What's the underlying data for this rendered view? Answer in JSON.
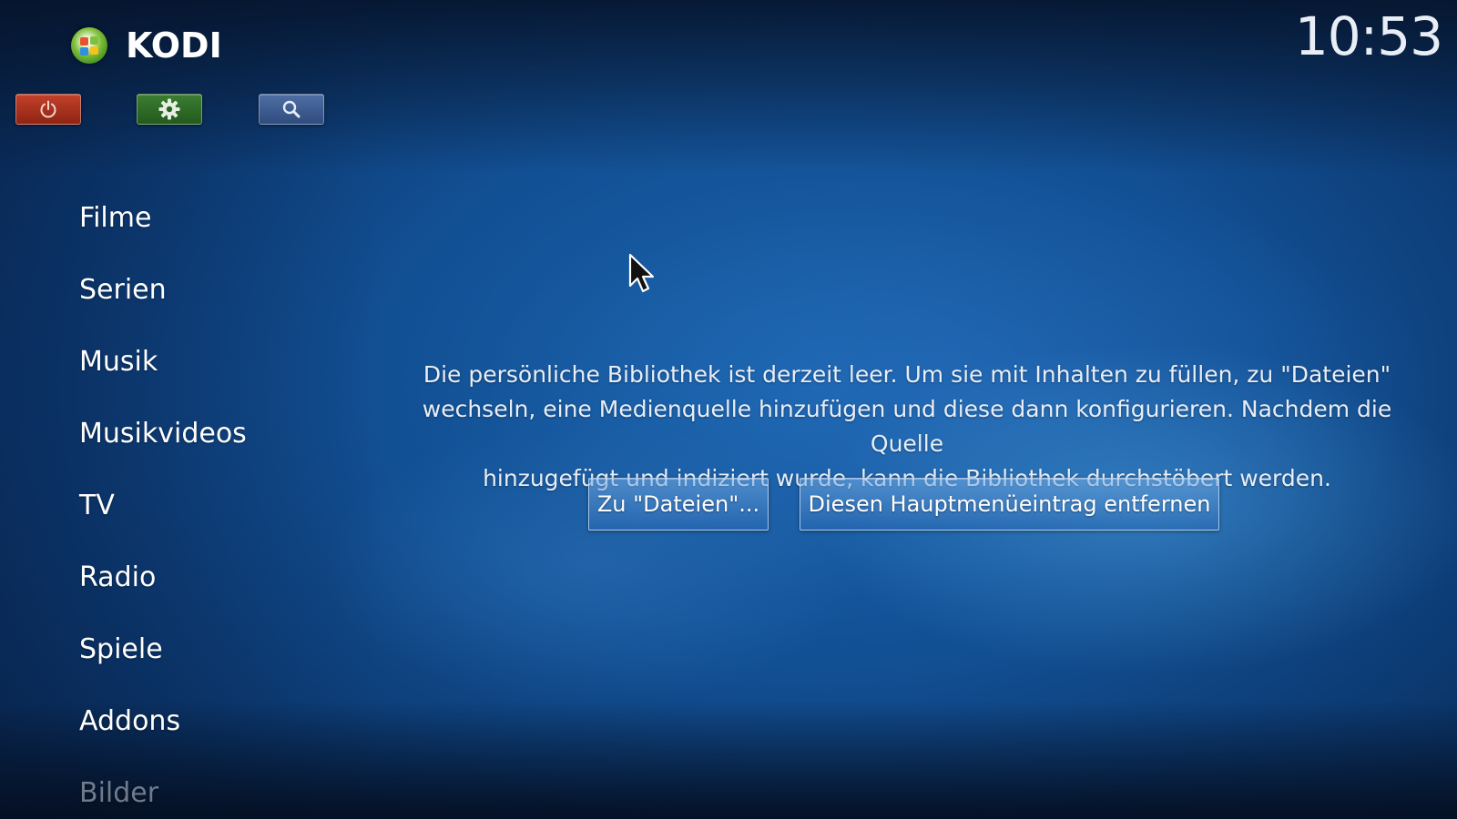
{
  "app": {
    "title": "KODI",
    "clock": "10:53"
  },
  "toolbar": {
    "power_icon": "power-icon",
    "settings_icon": "gear-icon",
    "search_icon": "search-icon",
    "colors": {
      "power": "#b0351f",
      "settings": "#2f6b28",
      "search": "#3f5d90"
    }
  },
  "menu": {
    "items": [
      {
        "label": "Filme"
      },
      {
        "label": "Serien"
      },
      {
        "label": "Musik"
      },
      {
        "label": "Musikvideos"
      },
      {
        "label": "TV"
      },
      {
        "label": "Radio"
      },
      {
        "label": "Spiele"
      },
      {
        "label": "Addons"
      },
      {
        "label": "Bilder"
      }
    ]
  },
  "main": {
    "message_line1": "Die persönliche Bibliothek ist derzeit leer. Um sie mit Inhalten zu füllen, zu \"Dateien\"",
    "message_line2": "wechseln, eine Medienquelle hinzufügen und diese dann konfigurieren. Nachdem die Quelle",
    "message_line3": "hinzugefügt und indiziert wurde, kann die Bibliothek durchstöbert werden.",
    "goto_button": "Zu \"Dateien\"...",
    "remove_button": "Diesen Hauptmenüeintrag entfernen"
  }
}
